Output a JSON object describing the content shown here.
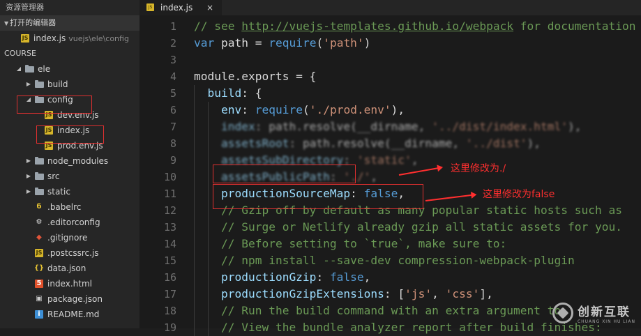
{
  "sidebar": {
    "title": "资源管理器",
    "open_editors_label": "打开的编辑器",
    "open_file": {
      "name": "index.js",
      "path": "vuejs\\ele\\config"
    },
    "course_label": "COURSE",
    "tree": [
      {
        "label": "ele",
        "icon": "folder-open-icon",
        "expanded": true
      },
      {
        "label": "build",
        "icon": "folder-icon",
        "expanded": false
      },
      {
        "label": "config",
        "icon": "folder-open-icon",
        "expanded": true
      },
      {
        "label": "dev.env.js",
        "icon": "js-file-icon"
      },
      {
        "label": "index.js",
        "icon": "js-file-icon"
      },
      {
        "label": "prod.env.js",
        "icon": "js-file-icon"
      },
      {
        "label": "node_modules",
        "icon": "folder-icon",
        "expanded": false
      },
      {
        "label": "src",
        "icon": "folder-icon",
        "expanded": false
      },
      {
        "label": "static",
        "icon": "folder-icon",
        "expanded": false
      },
      {
        "label": ".babelrc",
        "icon": "babel-file-icon"
      },
      {
        "label": ".editorconfig",
        "icon": "editorconfig-file-icon"
      },
      {
        "label": ".gitignore",
        "icon": "git-file-icon"
      },
      {
        "label": ".postcssrc.js",
        "icon": "js-file-icon"
      },
      {
        "label": "data.json",
        "icon": "json-file-icon"
      },
      {
        "label": "index.html",
        "icon": "html-file-icon"
      },
      {
        "label": "package.json",
        "icon": "npm-file-icon"
      },
      {
        "label": "README.md",
        "icon": "markdown-file-icon"
      }
    ]
  },
  "editor": {
    "tab": {
      "name": "index.js",
      "close": "×"
    },
    "lines": [
      {
        "n": "1",
        "text": "// see http://vuejs-templates.github.io/webpack for documentation"
      },
      {
        "n": "2",
        "text": "var path = require('path')"
      },
      {
        "n": "3",
        "text": ""
      },
      {
        "n": "4",
        "text": "module.exports = {"
      },
      {
        "n": "5",
        "text": "  build: {"
      },
      {
        "n": "6",
        "text": "    env: require('./prod.env'),"
      },
      {
        "n": "7",
        "text": "    index: path.resolve(__dirname, '../dist/index.html'),"
      },
      {
        "n": "8",
        "text": "    assetsRoot: path.resolve(__dirname, '../dist'),"
      },
      {
        "n": "9",
        "text": "    assetsSubDirectory: 'static',"
      },
      {
        "n": "10",
        "text": "    assetsPublicPath: './',"
      },
      {
        "n": "11",
        "text": "    productionSourceMap: false,"
      },
      {
        "n": "12",
        "text": "    // Gzip off by default as many popular static hosts such as"
      },
      {
        "n": "13",
        "text": "    // Surge or Netlify already gzip all static assets for you."
      },
      {
        "n": "14",
        "text": "    // Before setting to `true`, make sure to:"
      },
      {
        "n": "15",
        "text": "    // npm install --save-dev compression-webpack-plugin"
      },
      {
        "n": "16",
        "text": "    productionGzip: false,"
      },
      {
        "n": "17",
        "text": "    productionGzipExtensions: ['js', 'css'],"
      },
      {
        "n": "18",
        "text": "    // Run the build command with an extra argument to"
      },
      {
        "n": "19",
        "text": "    // View the bundle analyzer report after build finishes:"
      }
    ]
  },
  "annotations": {
    "note1": "这里修改为./",
    "note2": "这里修改为false",
    "color": "#ff2f2f"
  },
  "watermark": {
    "name": "创新互联",
    "sub": "CHUANG XIN HU LIAN"
  },
  "colors": {
    "sidebar_bg": "#262626",
    "editor_bg": "#1b1b1b",
    "comment": "#6a9955",
    "keyword": "#569cd6",
    "string": "#ce9178"
  }
}
